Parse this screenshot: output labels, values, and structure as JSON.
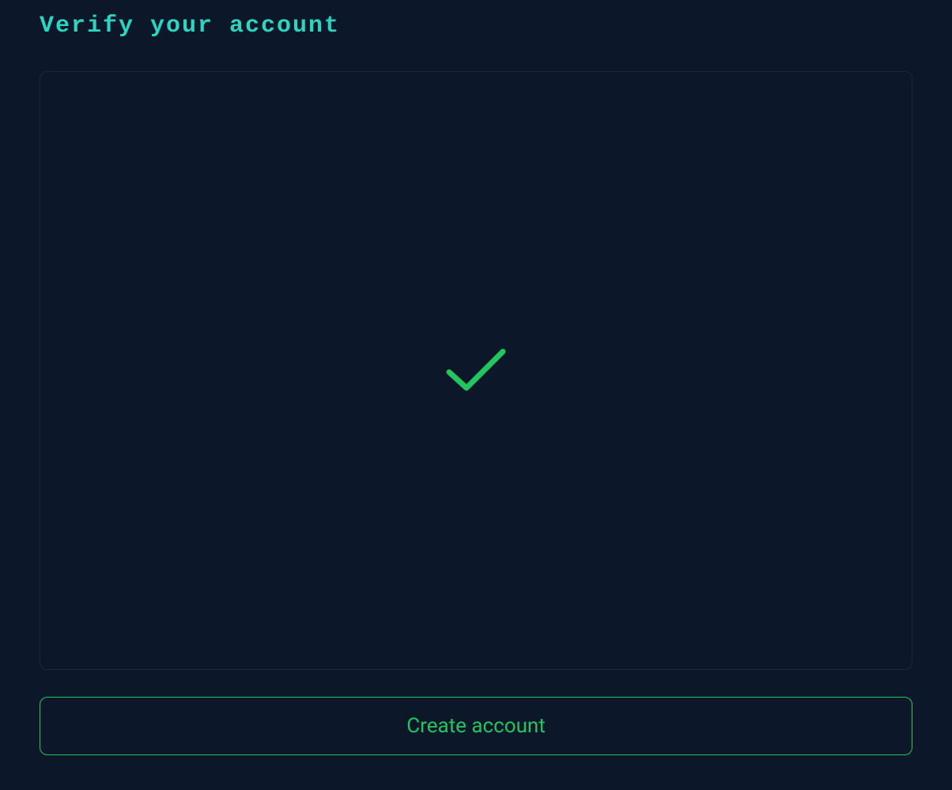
{
  "header": {
    "title": "Verify your account"
  },
  "action": {
    "create_label": "Create account"
  },
  "colors": {
    "accent_title": "#2dd4bf",
    "accent_action": "#22c55e",
    "bg": "#0c1729",
    "panel_border": "#1e293b"
  },
  "icons": {
    "check": "check-icon"
  }
}
